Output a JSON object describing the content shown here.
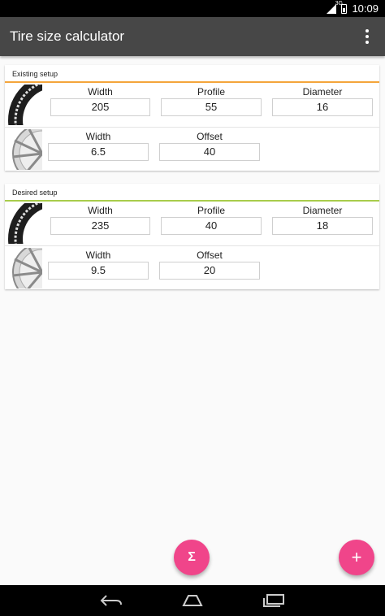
{
  "status_bar": {
    "time": "10:09",
    "network": "3G"
  },
  "app_bar": {
    "title": "Tire size calculator"
  },
  "existing": {
    "header": "Existing setup",
    "tire": {
      "width_label": "Width",
      "width_value": "205",
      "profile_label": "Profile",
      "profile_value": "55",
      "diameter_label": "Diameter",
      "diameter_value": "16"
    },
    "wheel": {
      "width_label": "Width",
      "width_value": "6.5",
      "offset_label": "Offset",
      "offset_value": "40"
    }
  },
  "desired": {
    "header": "Desired setup",
    "tire": {
      "width_label": "Width",
      "width_value": "235",
      "profile_label": "Profile",
      "profile_value": "40",
      "diameter_label": "Diameter",
      "diameter_value": "18"
    },
    "wheel": {
      "width_label": "Width",
      "width_value": "9.5",
      "offset_label": "Offset",
      "offset_value": "20"
    }
  },
  "fab": {
    "calculate": "Σ",
    "add": "+"
  },
  "colors": {
    "app_bar": "#474747",
    "existing_accent": "#f4a53b",
    "desired_accent": "#a8cc4b",
    "fab": "#f0458a"
  }
}
